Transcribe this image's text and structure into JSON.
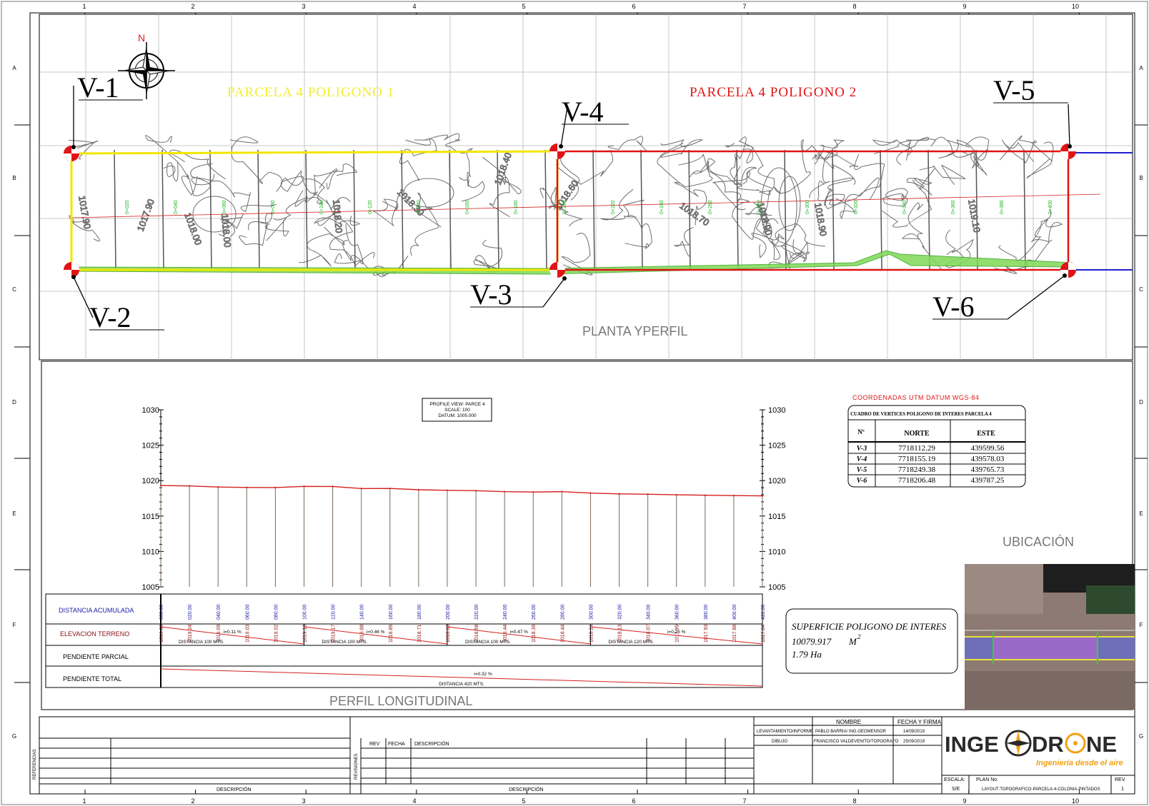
{
  "frame": {
    "columns": [
      "1",
      "2",
      "3",
      "4",
      "5",
      "6",
      "7",
      "8",
      "9",
      "10"
    ],
    "rows": [
      "A",
      "B",
      "C",
      "D",
      "E",
      "F",
      "G"
    ]
  },
  "plan": {
    "north_label": "N",
    "parcel_1_title": "PARCELA  4  POLIGONO  1",
    "parcel_2_title": "PARCELA  4  POLIGONO  2",
    "section_title": "PLANTA YPERFIL",
    "vertices": {
      "v1": "V-1",
      "v2": "V-2",
      "v3": "V-3",
      "v4": "V-4",
      "v5": "V-5",
      "v6": "V-6"
    },
    "contour_labels": [
      "1017.90",
      "1017.90",
      "1018.00",
      "1018.00",
      "1018.20",
      "1018.30",
      "1018.40",
      "1018.60",
      "1018.70",
      "1018.90",
      "1018.90",
      "1019.10"
    ],
    "station_labels": [
      "0+020",
      "0+040",
      "0+060",
      "0+080",
      "0+100",
      "0+120",
      "0+140",
      "0+160",
      "0+180",
      "0+200",
      "0+220",
      "0+240",
      "0+260",
      "0+280",
      "0+300",
      "0+320",
      "0+340",
      "0+360",
      "0+380",
      "0+400"
    ]
  },
  "profile": {
    "view_box": {
      "line1": "PROFILE VIEW: PARCE 4",
      "line2": "SCALE: 100",
      "line3": "DATUM: 1005.000"
    },
    "section_title": "PERFIL LONGITUDINAL",
    "row_labels": {
      "distance": "DISTANCIA  ACUMULADA",
      "elevation": "ELEVACION  TERRENO",
      "partial_slope": "PENDIENTE   PARCIAL",
      "total_slope": "PENDIENTE   TOTAL"
    },
    "distances": [
      "000.00",
      "020.00",
      "040.00",
      "060.00",
      "080.00",
      "100.00",
      "120.00",
      "140.00",
      "160.00",
      "180.00",
      "200.00",
      "220.00",
      "240.00",
      "260.00",
      "280.00",
      "300.00",
      "320.00",
      "340.00",
      "360.00",
      "380.00",
      "400.00",
      "420.00"
    ],
    "elevations": [
      "1019.30",
      "1019.24",
      "1019.09",
      "1019.03",
      "1019.02",
      "1019.18",
      "1019.17",
      "1018.88",
      "1018.89",
      "1018.71",
      "1018.63",
      "1018.58",
      "1018.44",
      "1018.39",
      "1018.44",
      "1018.24",
      "1018.13",
      "1018.07",
      "1017.99",
      "1017.93",
      "1017.88",
      "1017.84"
    ],
    "partial_slopes": [
      {
        "slope": "i=0.11  %",
        "distance": "DISTANCIA  100  MTS."
      },
      {
        "slope": "i=0.46  %",
        "distance": "DISTANCIA  100  MTS."
      },
      {
        "slope": "i=0.47  %",
        "distance": "DISTANCIA  100  MTS."
      },
      {
        "slope": "i=0.25  %",
        "distance": "DISTANCIA  120  MTS."
      }
    ],
    "total_slope": {
      "slope": "i=0.32  %",
      "distance": "DISTANCIA  420  MTS."
    }
  },
  "chart_data": {
    "type": "line",
    "title": "",
    "xlabel": "DISTANCIA  ACUMULADA",
    "ylabel": "",
    "ylim": [
      1005,
      1030
    ],
    "xlim": [
      0,
      420
    ],
    "y_ticks": [
      "1005",
      "1010",
      "1015",
      "1020",
      "1025",
      "1030"
    ],
    "series": [
      {
        "name": "ELEVACION  TERRENO",
        "x": [
          0,
          20,
          40,
          60,
          80,
          100,
          120,
          140,
          160,
          180,
          200,
          220,
          240,
          260,
          280,
          300,
          320,
          340,
          360,
          380,
          400,
          420
        ],
        "values": [
          1019.3,
          1019.24,
          1019.09,
          1019.03,
          1019.02,
          1019.18,
          1019.17,
          1018.88,
          1018.89,
          1018.71,
          1018.63,
          1018.58,
          1018.44,
          1018.39,
          1018.44,
          1018.24,
          1018.13,
          1018.07,
          1017.99,
          1017.93,
          1017.88,
          1017.84
        ]
      }
    ],
    "grid": false,
    "legend": "none"
  },
  "coordinates": {
    "header": "COORDENADAS  UTM  DATUM  WGS-84",
    "table_title": "CUADRO  DE  VERTICES  POLIGONO  DE  INTERES  PARCELA  4",
    "columns": [
      "Nº",
      "NORTE",
      "ESTE"
    ],
    "rows": [
      [
        "V-3",
        "7718112.29",
        "439599.56"
      ],
      [
        "V-4",
        "7718155.19",
        "439578.03"
      ],
      [
        "V-5",
        "7718249.38",
        "439765.73"
      ],
      [
        "V-6",
        "7718206.48",
        "439787.25"
      ]
    ]
  },
  "surface": {
    "title": "SUPERFICIE  POLIGONO  DE  INTERES",
    "area_m2": "10079.917",
    "unit_m2": "M",
    "unit_sup": "2",
    "area_ha": "1.79  Ha"
  },
  "location": {
    "title": "UBICACIÓN"
  },
  "title_block": {
    "references_label": "REFERENCIAS",
    "revisions_label": "REVISIONES",
    "rev_label": "REV",
    "fecha_label": "FECHA",
    "descripcion_label": "DESCRIPCIÓN",
    "descripcion_bottom_left": "DESCRIPCIÓN",
    "descripcion_bottom_mid": "DESCRIPCIÓN",
    "nombre_label": "NOMBRE",
    "fecha_firma_label": "FECHA  Y  FIRMA",
    "survey_role": "LEVANTAMIENTO/INFORME",
    "survey_name": "PABLO  BARRIA/  ING.GEOMENSOR",
    "survey_date": "14/09/2019",
    "drawing_role": "DIBUJO",
    "drawing_name": "FRANCISCO  VALDEVENITO/TOPOGRAFO",
    "drawing_date": "25/09/2019",
    "escala_label": "ESCALA:",
    "escala_value": "S/E",
    "plan_no_label": "PLAN  No",
    "plan_no_value": "LAYOUT-TOPOGRAFICO-PARCELA-4-COLONIA-PINTADOS",
    "rev_no_label": "REV.",
    "rev_no_value": "1",
    "logo_left": "INGE",
    "logo_right": "DR",
    "logo_end": "NE",
    "logo_tagline": "Ingeniería desde el aire"
  }
}
